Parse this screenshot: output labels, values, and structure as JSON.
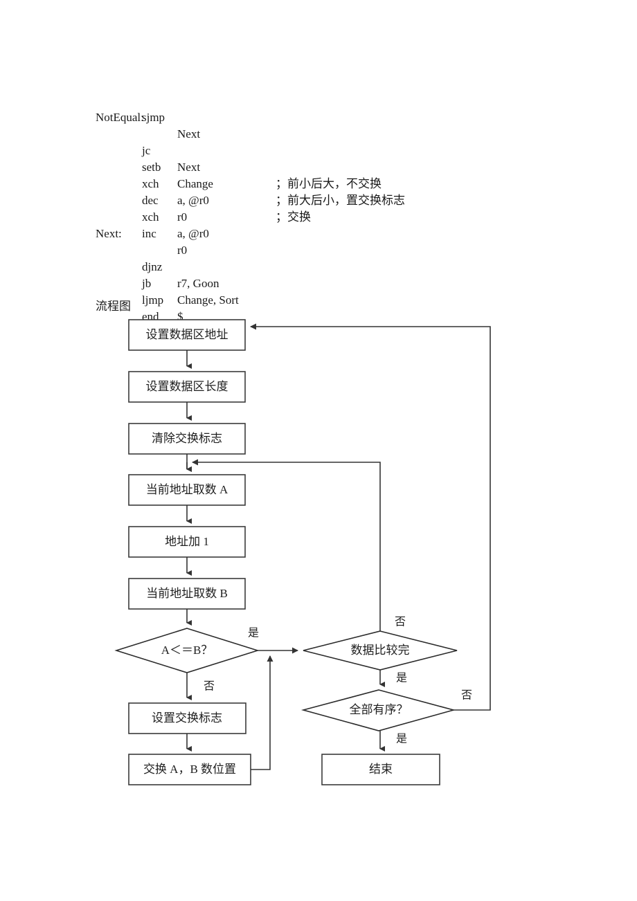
{
  "document": {
    "code_listing": [
      {
        "label": "",
        "mnemonic": "sjmp",
        "operand": "Next",
        "comment": ""
      },
      {
        "label": "NotEqual:",
        "mnemonic": "",
        "operand": "",
        "comment": ""
      },
      {
        "label": "",
        "mnemonic": "jc",
        "operand": "Next",
        "comment": "；前小后大，不交换"
      },
      {
        "label": "",
        "mnemonic": "setb",
        "operand": "Change",
        "comment": "；前大后小，置交换标志"
      },
      {
        "label": "",
        "mnemonic": "xch",
        "operand": "a, @r0",
        "comment": "；交换"
      },
      {
        "label": "",
        "mnemonic": "dec",
        "operand": "r0",
        "comment": ""
      },
      {
        "label": "",
        "mnemonic": "xch",
        "operand": "a, @r0",
        "comment": ""
      },
      {
        "label": "",
        "mnemonic": "inc",
        "operand": "r0",
        "comment": ""
      },
      {
        "label": "Next:",
        "mnemonic": "",
        "operand": "",
        "comment": ""
      },
      {
        "label": "",
        "mnemonic": "djnz",
        "operand": "r7, Goon",
        "comment": ""
      },
      {
        "label": "",
        "mnemonic": "jb",
        "operand": "Change, Sort",
        "comment": ""
      },
      {
        "label": "",
        "mnemonic": "ljmp",
        "operand": "$",
        "comment": ""
      },
      {
        "label": "",
        "mnemonic": "end",
        "operand": "",
        "comment": ""
      }
    ],
    "flowchart_caption": "流程图"
  },
  "flowchart": {
    "nodes": {
      "set_addr": {
        "label": "设置数据区地址"
      },
      "set_len": {
        "label": "设置数据区长度"
      },
      "clear_flag": {
        "label": "清除交换标志"
      },
      "load_a": {
        "label": "当前地址取数 A"
      },
      "addr_inc": {
        "label": "地址加 1"
      },
      "load_b": {
        "label": "当前地址取数 B"
      },
      "cmp_ab": {
        "label": "A＜＝B？"
      },
      "set_swapflag": {
        "label": "设置交换标志"
      },
      "swap_ab": {
        "label": "交换 A，B 数位置"
      },
      "cmp_done": {
        "label": "数据比较完"
      },
      "all_sorted": {
        "label": "全部有序？"
      },
      "end": {
        "label": "结束"
      }
    },
    "edge_labels": {
      "cmp_ab_yes": "是",
      "cmp_ab_no": "否",
      "cmp_done_no": "否",
      "cmp_done_yes": "是",
      "all_sorted_no": "否",
      "all_sorted_yes": "是"
    },
    "colors": {
      "stroke": "#333333",
      "box_fill": "#ffffff",
      "text": "#1f1f1f"
    }
  }
}
